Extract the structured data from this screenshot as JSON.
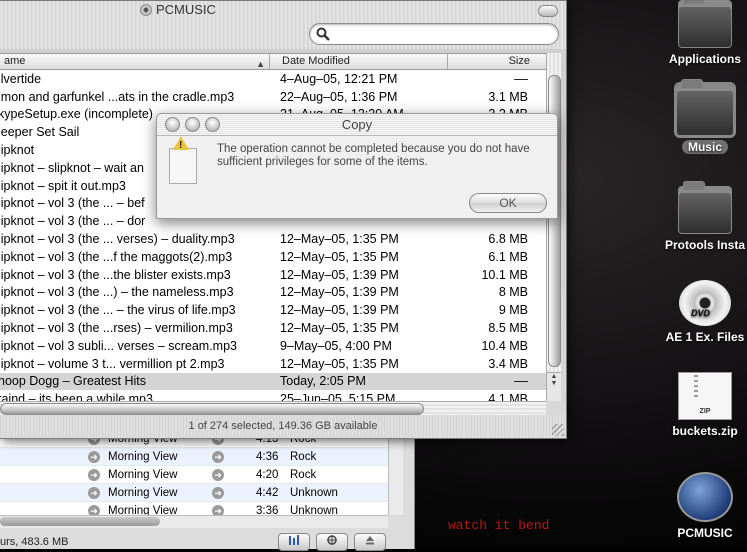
{
  "finder": {
    "title": "PCMUSIC",
    "search_placeholder": "",
    "columns": {
      "name": "ame",
      "date": "Date Modified",
      "size": "Size"
    },
    "rows": [
      {
        "name": "ilvertide",
        "date": "4–Aug–05, 12:21 PM",
        "size": "––"
      },
      {
        "name": "imon and garfunkel ...ats in the cradle.mp3",
        "date": "22–Aug–05, 1:36 PM",
        "size": "3.1 MB"
      },
      {
        "name": "kypeSetup.exe (incomplete)",
        "date": "21–Aug–05, 12:20 AM",
        "size": "3.2 MB"
      },
      {
        "name": "leeper Set Sail",
        "date": "",
        "size": ""
      },
      {
        "name": "lipknot",
        "date": "",
        "size": ""
      },
      {
        "name": "lipknot – slipknot – wait an",
        "date": "",
        "size": ""
      },
      {
        "name": "lipknot – spit it out.mp3",
        "date": "",
        "size": ""
      },
      {
        "name": "lipknot – vol 3 (the ... – bef",
        "date": "",
        "size": ""
      },
      {
        "name": "lipknot – vol 3 (the ... – dor",
        "date": "",
        "size": ""
      },
      {
        "name": "lipknot – vol 3 (the ... verses) – duality.mp3",
        "date": "12–May–05, 1:35 PM",
        "size": "6.8 MB"
      },
      {
        "name": "lipknot – vol 3 (the ...f the maggots(2).mp3",
        "date": "12–May–05, 1:35 PM",
        "size": "6.1 MB"
      },
      {
        "name": "lipknot – vol 3 (the ...the blister exists.mp3",
        "date": "12–May–05, 1:39 PM",
        "size": "10.1 MB"
      },
      {
        "name": "lipknot – vol 3 (the ...) – the nameless.mp3",
        "date": "12–May–05, 1:39 PM",
        "size": "8 MB"
      },
      {
        "name": "lipknot – vol 3 (the ... – the virus of life.mp3",
        "date": "12–May–05, 1:39 PM",
        "size": "9 MB"
      },
      {
        "name": "lipknot – vol 3 (the ...rses) – vermilion.mp3",
        "date": "12–May–05, 1:35 PM",
        "size": "8.5 MB"
      },
      {
        "name": "lipknot – vol 3 subli... verses – scream.mp3",
        "date": "9–May–05, 4:00 PM",
        "size": "10.4 MB"
      },
      {
        "name": "lipknot – volume 3 t... vermillion pt 2.mp3",
        "date": "12–May–05, 1:35 PM",
        "size": "3.4 MB"
      },
      {
        "name": "noop Dogg – Greatest Hits",
        "date": "Today, 2:05 PM",
        "size": "––"
      },
      {
        "name": "taind – its been a while.mp3",
        "date": "25–Jun–05, 5:15 PM",
        "size": "4.1 MB"
      }
    ],
    "selected_row": 17,
    "status": "1 of 274 selected, 149.36 GB available"
  },
  "dialog": {
    "title": "Copy",
    "message": "The operation cannot be completed because you do not have sufficient privileges for some of the items.",
    "ok_label": "OK"
  },
  "back_window": {
    "rows": [
      {
        "album": "Morning View",
        "time": "4:13",
        "genre": "Rock"
      },
      {
        "album": "Morning View",
        "time": "4:36",
        "genre": "Rock"
      },
      {
        "album": "Morning View",
        "time": "4:20",
        "genre": "Rock"
      },
      {
        "album": "Morning View",
        "time": "4:42",
        "genre": "Unknown"
      },
      {
        "album": "Morning View",
        "time": "3:36",
        "genre": "Unknown"
      }
    ],
    "status": "urs, 483.6 MB"
  },
  "desktop": {
    "icons": [
      {
        "label": "Applications",
        "kind": "folder"
      },
      {
        "label": "Music",
        "kind": "folder"
      },
      {
        "label": "Protools Insta",
        "kind": "folder"
      },
      {
        "label": "AE 1 Ex. Files",
        "kind": "disc"
      },
      {
        "label": "buckets.zip",
        "kind": "zip"
      },
      {
        "label": "PCMUSIC",
        "kind": "globe"
      }
    ],
    "wallpaper_text": "watch it bend",
    "dvd_label": "DVD",
    "zip_label": "ZIP"
  },
  "colors": {
    "selection": "#d4d4d4",
    "wallpaper_text": "#b81818"
  }
}
